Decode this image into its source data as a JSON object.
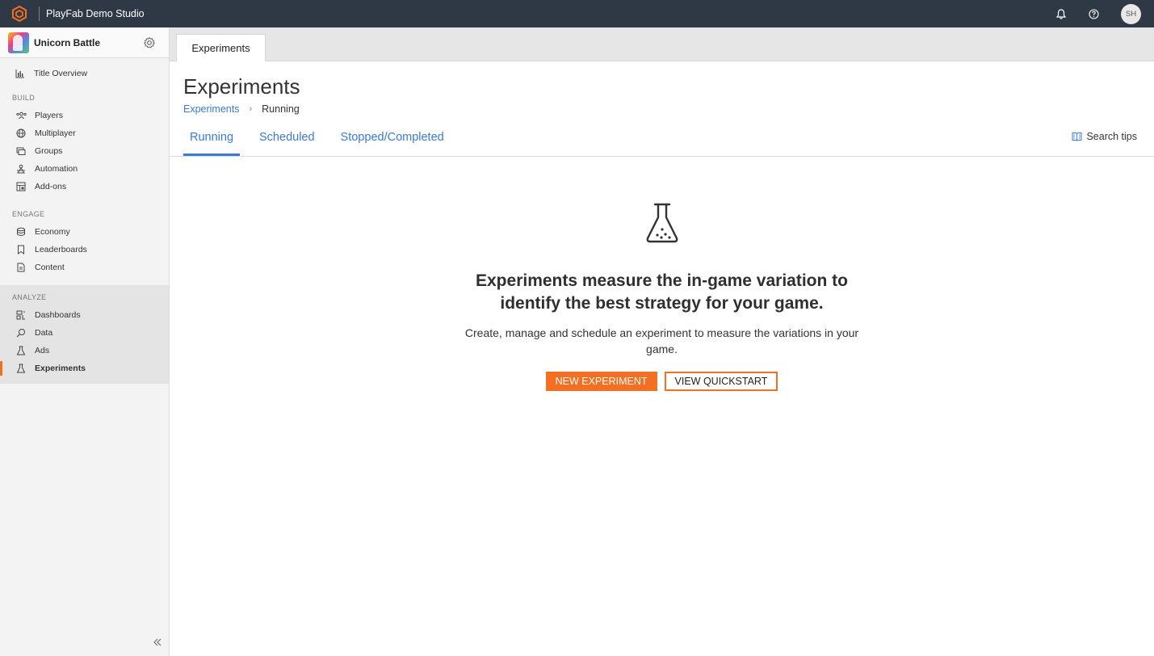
{
  "topbar": {
    "studio_name": "PlayFab Demo Studio",
    "avatar_initials": "SH",
    "icons": [
      "playfab-logo-icon",
      "bell-icon",
      "help-icon"
    ]
  },
  "sidebar": {
    "title_name": "Unicorn Battle",
    "overview_label": "Title Overview",
    "sections": {
      "build": "BUILD",
      "engage": "ENGAGE",
      "analyze": "ANALYZE"
    },
    "build_items": [
      {
        "label": "Players",
        "icon": "players-icon"
      },
      {
        "label": "Multiplayer",
        "icon": "globe-icon"
      },
      {
        "label": "Groups",
        "icon": "groups-icon"
      },
      {
        "label": "Automation",
        "icon": "automation-icon"
      },
      {
        "label": "Add-ons",
        "icon": "addons-icon"
      }
    ],
    "engage_items": [
      {
        "label": "Economy",
        "icon": "economy-icon"
      },
      {
        "label": "Leaderboards",
        "icon": "bookmark-icon"
      },
      {
        "label": "Content",
        "icon": "document-icon"
      }
    ],
    "analyze_items": [
      {
        "label": "Dashboards",
        "icon": "dashboard-icon"
      },
      {
        "label": "Data",
        "icon": "data-icon"
      },
      {
        "label": "Ads",
        "icon": "flask-icon"
      },
      {
        "label": "Experiments",
        "icon": "flask-icon",
        "active": true
      }
    ]
  },
  "main": {
    "open_tab": "Experiments",
    "page_title": "Experiments",
    "breadcrumb": {
      "link": "Experiments",
      "current": "Running"
    },
    "subtabs": [
      {
        "label": "Running",
        "active": true
      },
      {
        "label": "Scheduled"
      },
      {
        "label": "Stopped/Completed"
      }
    ],
    "search_tips": "Search tips",
    "empty_state": {
      "heading": "Experiments measure the in-game variation to identify the best strategy for your game.",
      "subtext": "Create, manage and schedule an experiment to measure the variations in your game.",
      "primary_button": "NEW EXPERIMENT",
      "secondary_button": "VIEW QUICKSTART"
    }
  },
  "colors": {
    "topbar": "#2f3845",
    "accent_orange": "#f36f21",
    "link_blue": "#3a7bd5"
  }
}
